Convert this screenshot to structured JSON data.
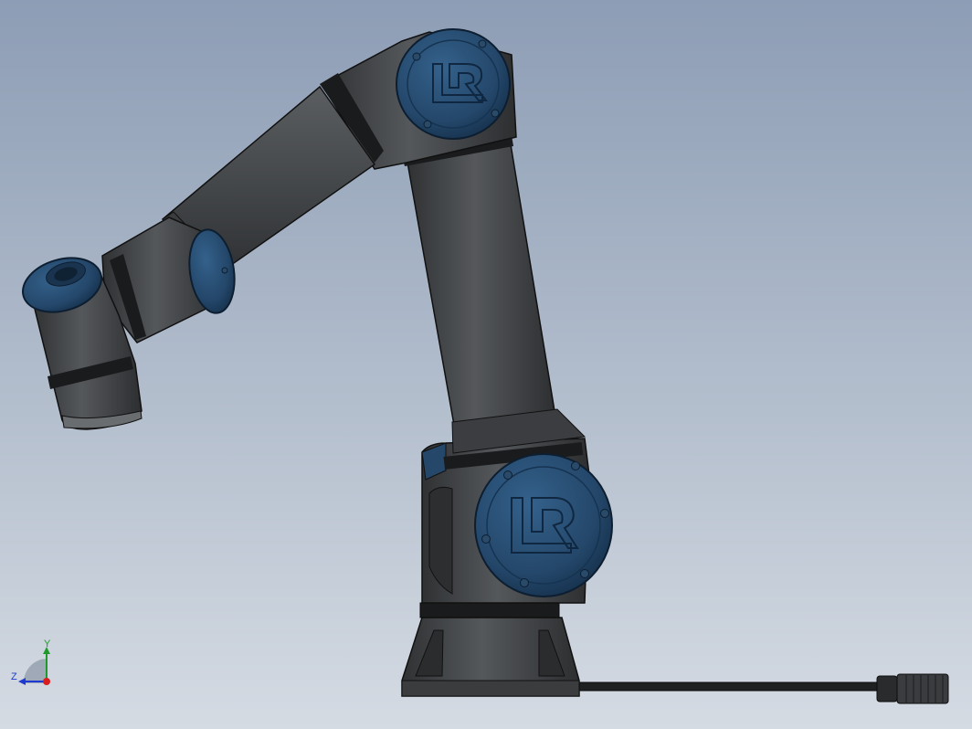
{
  "viewport": {
    "background_top": "#8d9db5",
    "background_bottom": "#d5dbe3"
  },
  "model": {
    "body_color": "#3f4143",
    "cap_color": "#24476a",
    "logo_text": "UR",
    "parts": [
      "base",
      "shoulder-joint",
      "upper-arm",
      "elbow-joint",
      "forearm",
      "wrist-1",
      "wrist-2",
      "wrist-3",
      "cable",
      "cable-connector"
    ]
  },
  "triad": {
    "y_label": "Y",
    "z_label": "Z",
    "y_color": "#1e9a2c",
    "z_color": "#1e3ad0",
    "x_color": "#d81e1e"
  }
}
